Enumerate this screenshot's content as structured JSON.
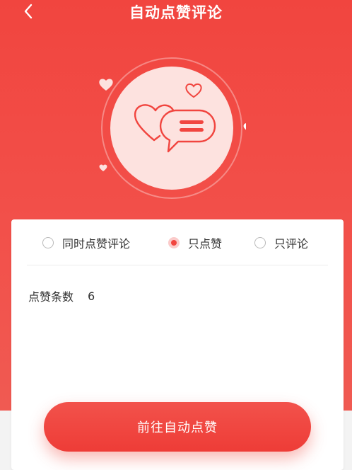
{
  "header": {
    "title": "自动点赞评论",
    "back_icon": "chevron-left-icon"
  },
  "hero": {
    "icons": [
      "hearts-speech-bubble-icon",
      "heart-icon"
    ]
  },
  "mode_options": [
    {
      "label": "同时点赞评论",
      "checked": false
    },
    {
      "label": "只点赞",
      "checked": true
    },
    {
      "label": "只评论",
      "checked": false
    }
  ],
  "settings": {
    "count_label": "点赞条数",
    "count_value": "6"
  },
  "action": {
    "button_label": "前往自动点赞"
  },
  "colors": {
    "accent": "#f1453f",
    "background": "#f3f3f3"
  }
}
